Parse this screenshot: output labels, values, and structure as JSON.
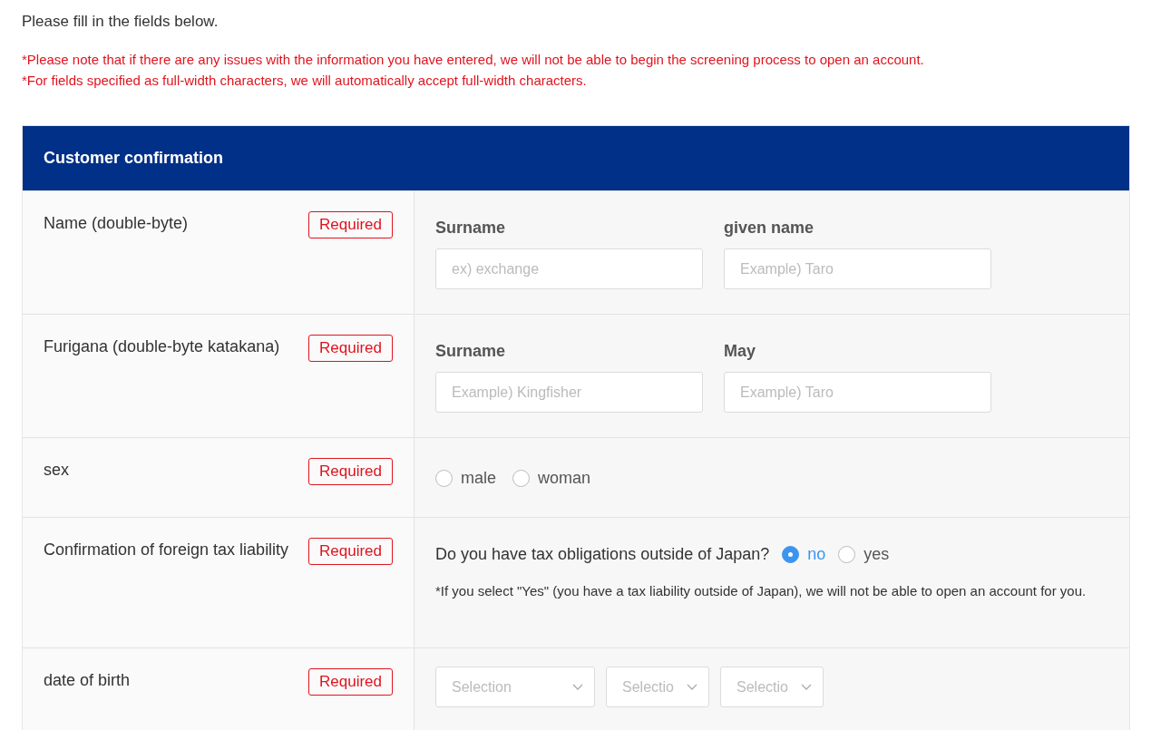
{
  "intro": "Please fill in the fields below.",
  "notes": [
    "*Please note that if there are any issues with the information you have entered, we will not be able to begin the screening process to open an account.",
    "*For fields specified as full-width characters, we will automatically accept full-width characters."
  ],
  "section": {
    "title": "Customer confirmation",
    "rows": [
      {
        "kind": "pair",
        "label": "Name (double-byte)",
        "badge": "Required",
        "fields": [
          {
            "label": "Surname",
            "placeholder": "ex) exchange"
          },
          {
            "label": "given name",
            "placeholder": "Example) Taro"
          }
        ]
      },
      {
        "kind": "pair",
        "label": "Furigana (double-byte katakana)",
        "badge": "Required",
        "fields": [
          {
            "label": "Surname",
            "placeholder": "Example) Kingfisher"
          },
          {
            "label": "May",
            "placeholder": "Example) Taro"
          }
        ]
      },
      {
        "kind": "radio",
        "label": "sex",
        "badge": "Required",
        "options": [
          {
            "label": "male",
            "selected": false
          },
          {
            "label": "woman",
            "selected": false
          }
        ]
      },
      {
        "kind": "question",
        "label": "Confirmation of foreign tax liability",
        "badge": "Required",
        "question": "Do you have tax obligations outside of Japan?",
        "options": [
          {
            "label": "no",
            "selected": true
          },
          {
            "label": "yes",
            "selected": false
          }
        ],
        "note": "*If you select \"Yes\" (you have a tax liability outside of Japan), we will not be able to open an account for you."
      },
      {
        "kind": "selects",
        "label": "date of birth",
        "badge": "Required",
        "selects": [
          {
            "placeholder": "Selection"
          },
          {
            "placeholder": "Selectio"
          },
          {
            "placeholder": "Selectio"
          }
        ]
      }
    ]
  }
}
